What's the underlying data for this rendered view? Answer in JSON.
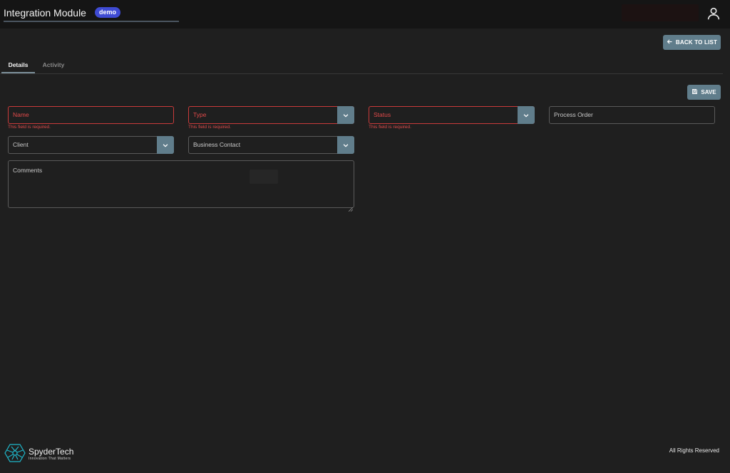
{
  "header": {
    "app_title": "Integration Module",
    "env_badge": "demo",
    "user_icon": "user-icon"
  },
  "actions": {
    "back_label": "BACK TO LIST",
    "save_label": "SAVE"
  },
  "tabs": [
    {
      "label": "Details",
      "active": true
    },
    {
      "label": "Activity",
      "active": false
    }
  ],
  "form": {
    "name": {
      "label": "Name",
      "error": "This field is required."
    },
    "type": {
      "label": "Type",
      "error": "This field is required."
    },
    "status": {
      "label": "Status",
      "error": "This field is required."
    },
    "process_order": {
      "label": "Process Order"
    },
    "client": {
      "label": "Client"
    },
    "business_contact": {
      "label": "Business Contact"
    },
    "comments": {
      "label": "Comments"
    }
  },
  "footer": {
    "brand_name": "SpyderTech",
    "brand_tagline": "Innovation That Matters",
    "copyright": "All Rights Reserved"
  },
  "colors": {
    "accent": "#607d8b",
    "error": "#e24a4a",
    "badge": "#3f4bd3",
    "logo": "#1fb6c9"
  }
}
